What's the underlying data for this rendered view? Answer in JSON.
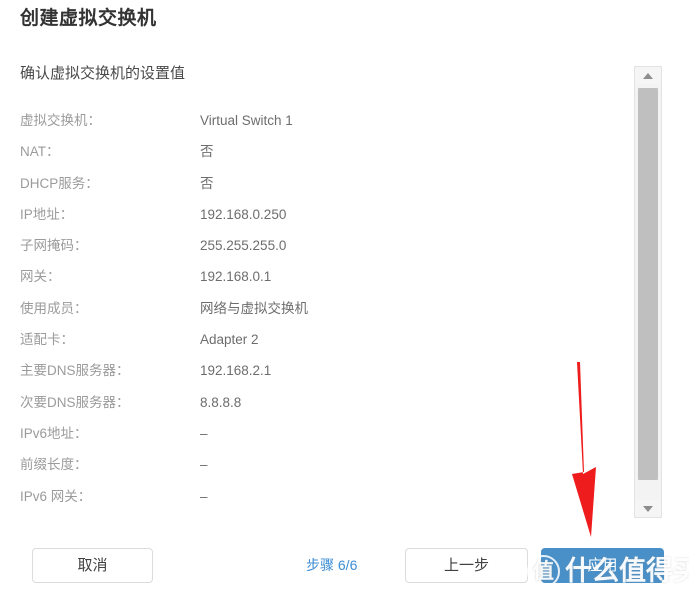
{
  "dialog": {
    "title": "创建虚拟交换机",
    "step_heading": "确认虚拟交换机的设置值"
  },
  "summary": {
    "rows": [
      {
        "label": "虚拟交换机：",
        "value": "Virtual Switch 1"
      },
      {
        "label": "NAT：",
        "value": "否"
      },
      {
        "label": "DHCP服务：",
        "value": "否"
      },
      {
        "label": "IP地址：",
        "value": "192.168.0.250"
      },
      {
        "label": "子网掩码：",
        "value": "255.255.255.0"
      },
      {
        "label": "网关：",
        "value": "192.168.0.1"
      },
      {
        "label": "使用成员：",
        "value": "网络与虚拟交换机"
      },
      {
        "label": "适配卡：",
        "value": "Adapter 2"
      },
      {
        "label": "主要DNS服务器：",
        "value": "192.168.2.1"
      },
      {
        "label": "次要DNS服务器：",
        "value": "8.8.8.8"
      },
      {
        "label": "IPv6地址：",
        "value": "–"
      },
      {
        "label": "前缀长度：",
        "value": "–"
      },
      {
        "label": "IPv6 网关：",
        "value": "–"
      }
    ]
  },
  "scrollbar": {
    "up_icon": "triangle-up-icon",
    "down_icon": "triangle-down-icon"
  },
  "footer": {
    "cancel_label": "取消",
    "step_indicator": "步骤 6/6",
    "previous_label": "上一步",
    "apply_label": "应用",
    "accent_color": "#4a90c8",
    "step_color": "#3c8dd4"
  },
  "annotation": {
    "arrow_icon": "red-down-arrow-icon",
    "color": "#ee1c1c"
  },
  "watermark": {
    "logo_text": "值",
    "text": "什么值得买"
  }
}
